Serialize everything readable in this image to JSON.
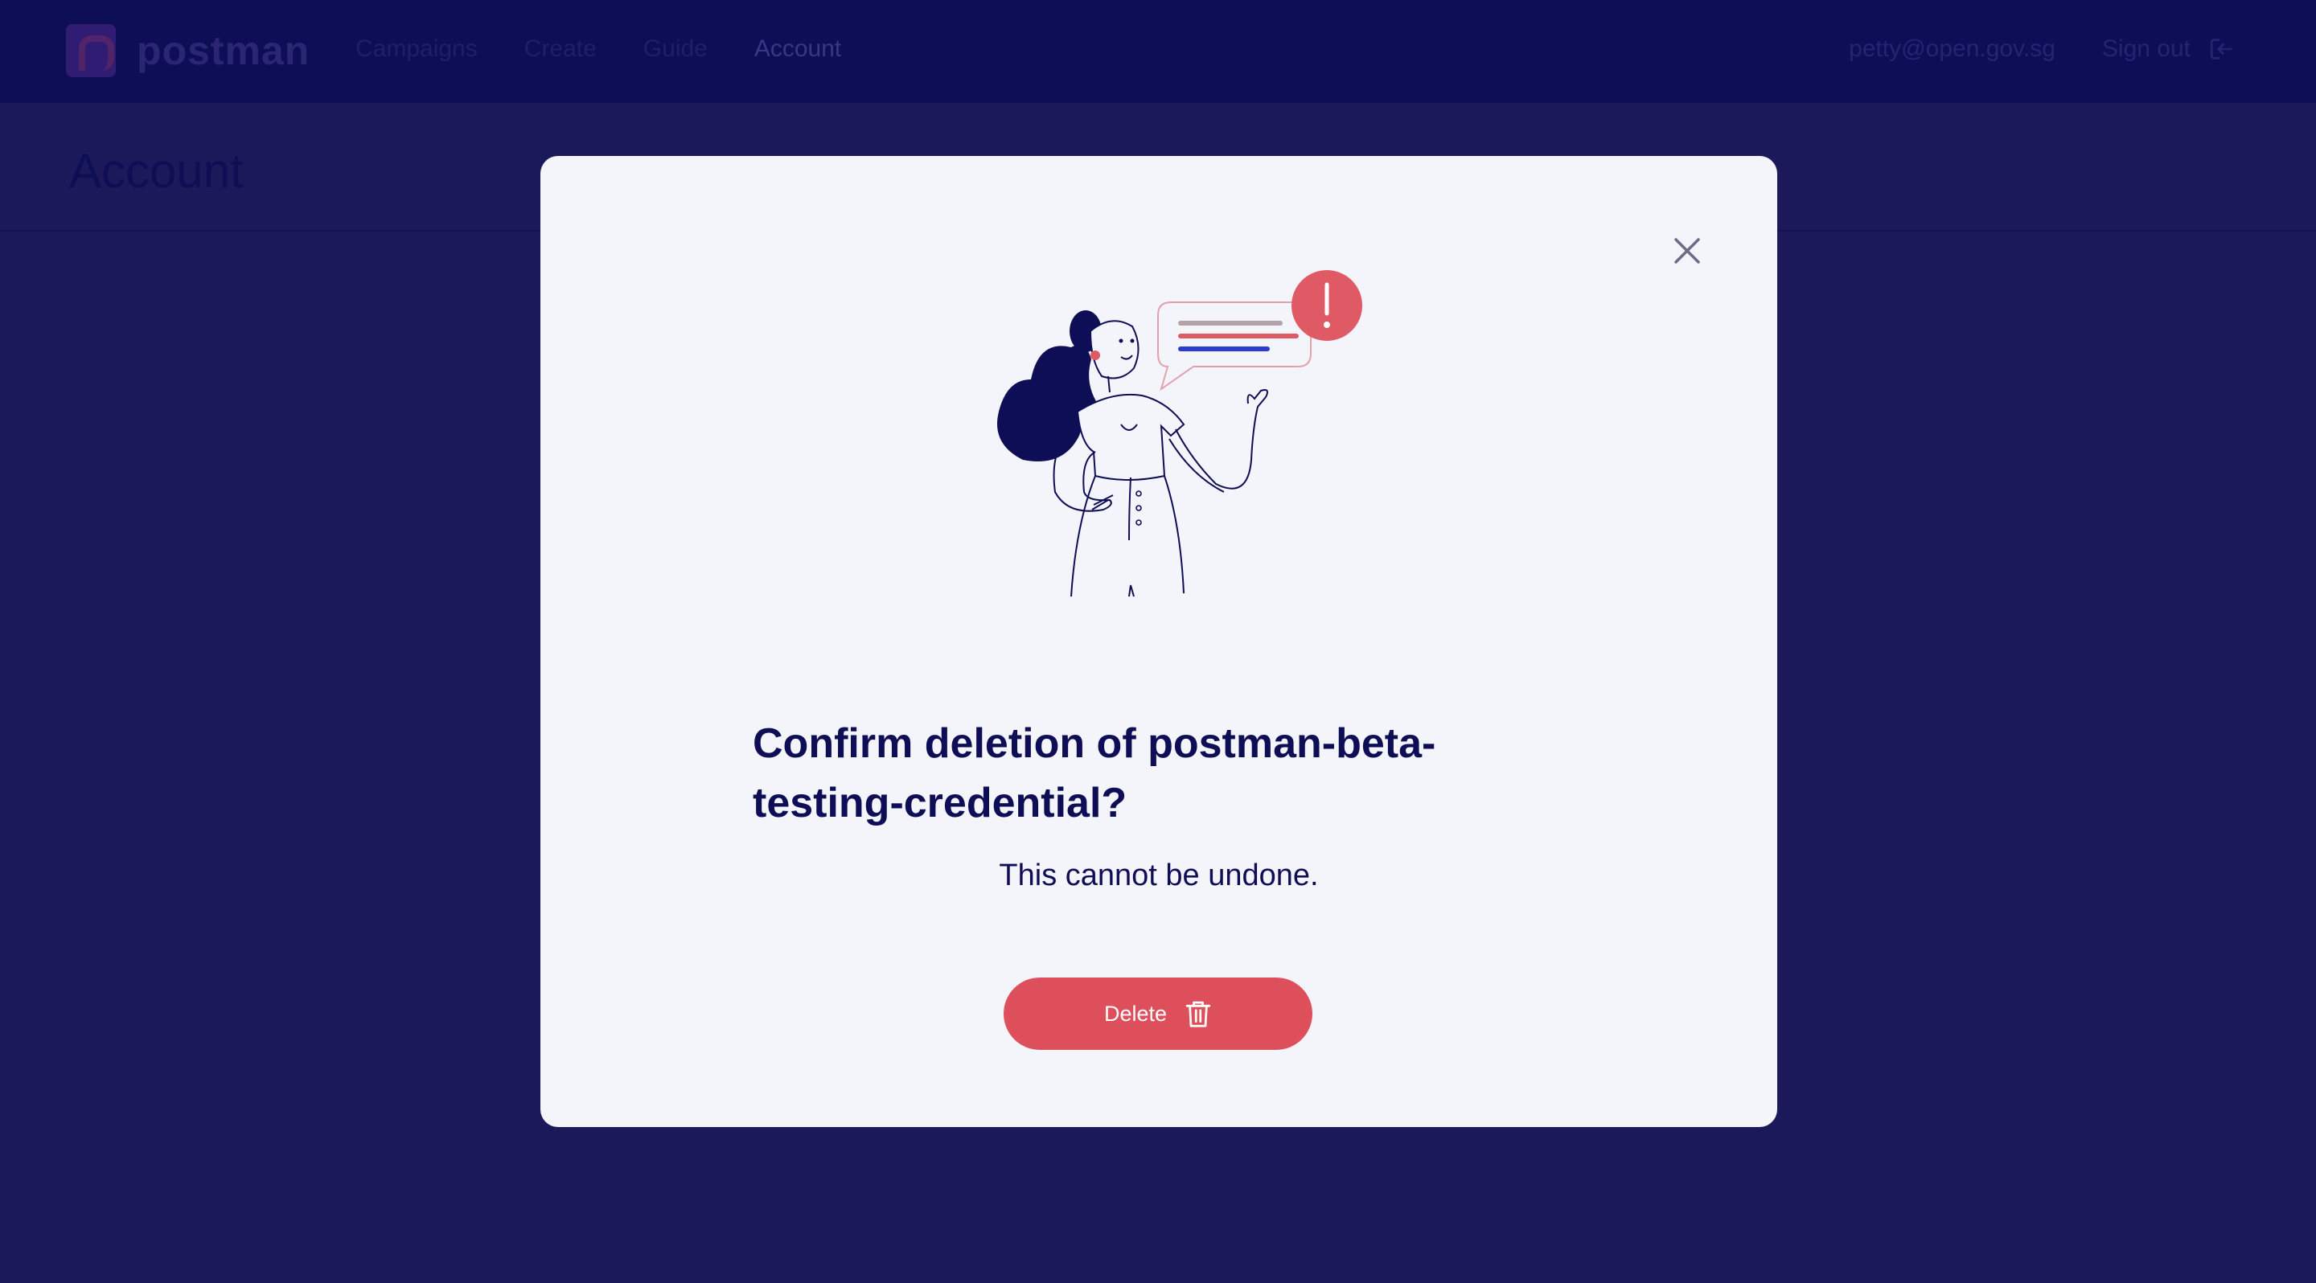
{
  "navbar": {
    "logo_text": "postman",
    "links": [
      {
        "label": "Campaigns"
      },
      {
        "label": "Create"
      },
      {
        "label": "Guide"
      },
      {
        "label": "Account"
      }
    ],
    "user_email": "petty@open.gov.sg",
    "sign_out_label": "Sign out",
    "sign_out_icon": "sign-out-icon"
  },
  "page": {
    "title": "Account"
  },
  "modal": {
    "close_icon": "close-icon",
    "illustration": "woman-alert-illustration",
    "title": "Confirm deletion of postman-beta-testing-credential?",
    "subtitle": "This cannot be undone.",
    "delete_label": "Delete",
    "delete_icon": "trash-icon"
  },
  "colors": {
    "overlay_bg": "#1b1959",
    "navbar_bg": "#0e0e56",
    "modal_bg": "#f4f5fa",
    "text_primary": "#0e0e56",
    "danger": "#de4f5c",
    "alert_red": "#e05a66",
    "accent_blue": "#2e3bd0"
  }
}
